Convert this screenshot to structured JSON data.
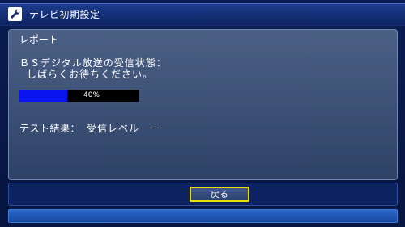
{
  "window": {
    "title": "テレビ初期設定",
    "icon": "wrench-icon"
  },
  "report": {
    "heading": "レポート",
    "status_line1": "ＢＳデジタル放送の受信状態：",
    "status_line2": "しばらくお待ちください。",
    "progress": {
      "percent": 40,
      "label": "40%"
    },
    "result_label": "テスト結果：",
    "result_value": "受信レベル　ー"
  },
  "buttons": {
    "back_label": "戻る"
  },
  "colors": {
    "progress_fill": "#0a14ee",
    "progress_track": "#000000",
    "focus_border": "#e8e000"
  }
}
